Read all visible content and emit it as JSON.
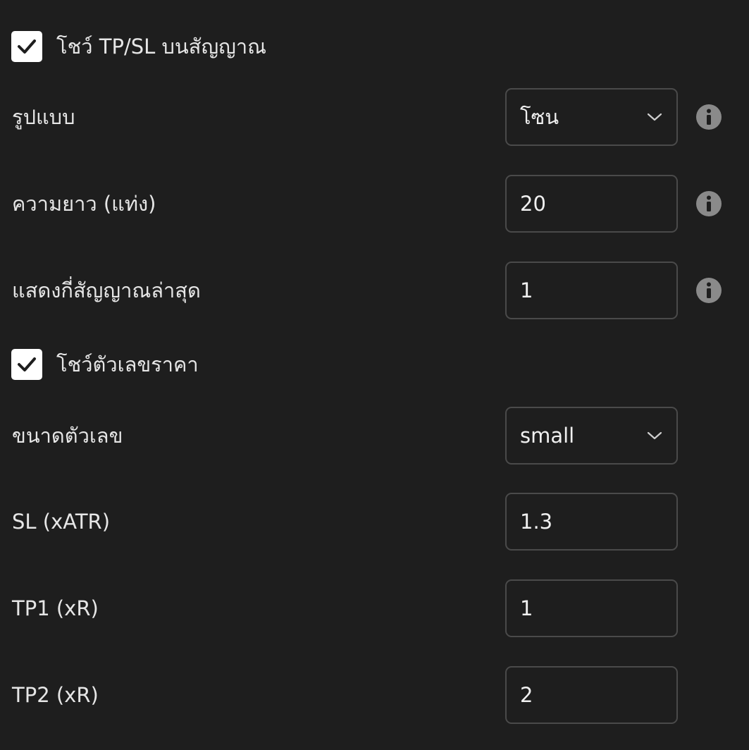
{
  "settings": {
    "show_tp_sl": {
      "label": "โชว์ TP/SL บนสัญญาณ",
      "checked": true
    },
    "style": {
      "label": "รูปแบบ",
      "value": "โซน",
      "icon": "chevron-down-icon"
    },
    "length": {
      "label": "ความยาว (แท่ง)",
      "value": "20"
    },
    "show_last": {
      "label": "แสดงกี่สัญญาณล่าสุด",
      "value": "1"
    },
    "show_price": {
      "label": "โชว์ตัวเลขราคา",
      "checked": true
    },
    "number_size": {
      "label": "ขนาดตัวเลข",
      "value": "small",
      "icon": "chevron-down-icon"
    },
    "sl_atr": {
      "label": "SL (xATR)",
      "value": "1.3"
    },
    "tp1": {
      "label": "TP1 (xR)",
      "value": "1"
    },
    "tp2": {
      "label": "TP2 (xR)",
      "value": "2"
    }
  },
  "colors": {
    "background": "#1e1e1e",
    "field_border": "#4a4a4a",
    "checkbox": "#ffffff",
    "info_icon": "#8a8a8a"
  }
}
